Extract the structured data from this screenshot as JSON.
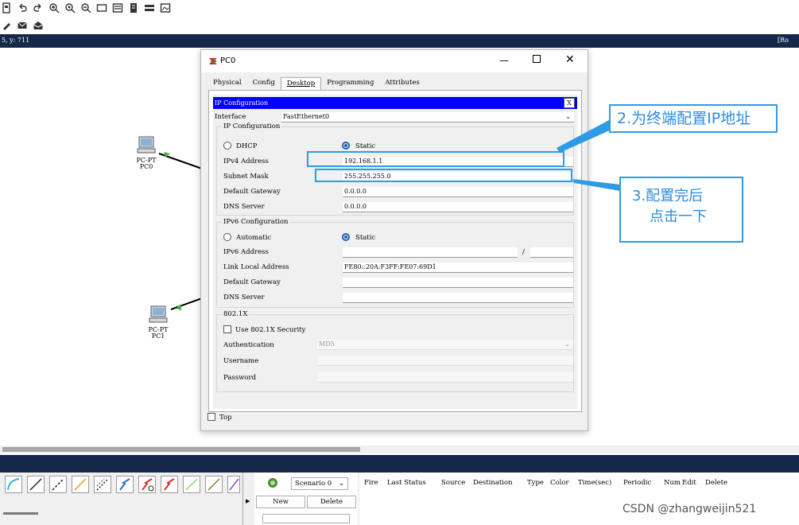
{
  "status": {
    "coords": "5, y: 711",
    "mode": "[Ro"
  },
  "devices": {
    "pc0": {
      "model": "PC-PT",
      "name": "PC0"
    },
    "pc1": {
      "model": "PC-PT",
      "name": "PC1"
    }
  },
  "dialog": {
    "title": "PC0",
    "tabs": [
      "Physical",
      "Config",
      "Desktop",
      "Programming",
      "Attributes"
    ],
    "active_tab": "Desktop",
    "ip_bar_title": "IP Configuration",
    "close_x": "X",
    "interface_label": "Interface",
    "interface_value": "FastEthernet0",
    "ipv4": {
      "group_title": "IP Configuration",
      "dhcp_label": "DHCP",
      "static_label": "Static",
      "ipv4_label": "IPv4 Address",
      "ipv4_value": "192.168.1.1",
      "mask_label": "Subnet Mask",
      "mask_value": "255.255.255.0",
      "gateway_label": "Default Gateway",
      "gateway_value": "0.0.0.0",
      "dns_label": "DNS Server",
      "dns_value": "0.0.0.0"
    },
    "ipv6": {
      "group_title": "IPv6 Configuration",
      "auto_label": "Automatic",
      "static_label": "Static",
      "addr_label": "IPv6 Address",
      "addr_value": "",
      "slash": "/",
      "linklocal_label": "Link Local Address",
      "linklocal_value": "FE80::20A:F3FF:FE07:69D1",
      "gateway_label": "Default Gateway",
      "dns_label": "DNS Server"
    },
    "dot1x": {
      "group_title": "802.1X",
      "use_label": "Use 802.1X Security",
      "auth_label": "Authentication",
      "auth_value": "MD5",
      "user_label": "Username",
      "pass_label": "Password"
    },
    "top_label": "Top"
  },
  "annotations": {
    "callout1": "2.为终端配置IP地址",
    "callout2_line1": "3.配置完后",
    "callout2_line2": "点击一下"
  },
  "scenario": {
    "select_value": "Scenario 0",
    "new_label": "New",
    "delete_label": "Delete"
  },
  "pdu_columns": [
    "Fire",
    "Last Status",
    "Source",
    "Destination",
    "Type",
    "Color",
    "Time(sec)",
    "Periodic",
    "Num",
    "Edit",
    "Delete"
  ],
  "watermark": "CSDN @zhangweijin521",
  "colors": {
    "navbar": "#16284a",
    "ip_bar": "#0000ff",
    "callout": "#2e9be6",
    "radio_on": "#1a5fb4"
  }
}
